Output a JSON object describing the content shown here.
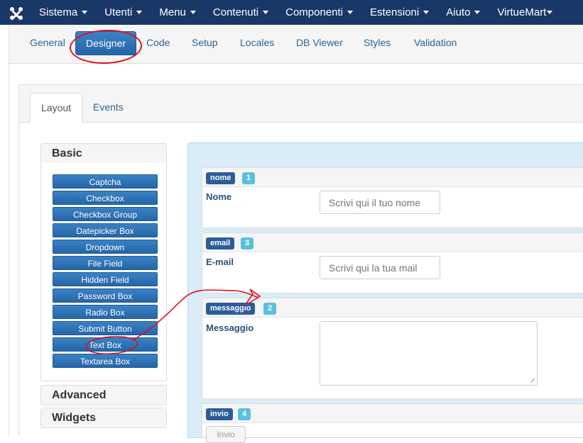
{
  "topbar": {
    "menu": [
      {
        "label": "Sistema",
        "caret": true
      },
      {
        "label": "Utenti",
        "caret": true
      },
      {
        "label": "Menu",
        "caret": true
      },
      {
        "label": "Contenuti",
        "caret": true
      },
      {
        "label": "Componenti",
        "caret": true
      },
      {
        "label": "Estensioni",
        "caret": true
      },
      {
        "label": "Aiuto",
        "caret": true
      },
      {
        "label": "VirtueMart",
        "caret": true
      }
    ]
  },
  "subnav": {
    "tabs": [
      {
        "label": "General",
        "active": false
      },
      {
        "label": "Designer",
        "active": true
      },
      {
        "label": "Code",
        "active": false
      },
      {
        "label": "Setup",
        "active": false
      },
      {
        "label": "Locales",
        "active": false
      },
      {
        "label": "DB Viewer",
        "active": false
      },
      {
        "label": "Styles",
        "active": false
      },
      {
        "label": "Validation",
        "active": false
      }
    ]
  },
  "panel": {
    "tabs": [
      {
        "label": "Layout",
        "active": true
      },
      {
        "label": "Events",
        "active": false
      }
    ]
  },
  "sidebar": {
    "basic_title": "Basic",
    "advanced_title": "Advanced",
    "widgets_title": "Widgets",
    "fields": [
      "Captcha",
      "Checkbox",
      "Checkbox Group",
      "Datepicker Box",
      "Dropdown",
      "File Field",
      "Hidden Field",
      "Password Box",
      "Radio Box",
      "Submit Button",
      "Text Box",
      "Textarea Box"
    ]
  },
  "form": {
    "cards": [
      {
        "tag": "nome",
        "badge": "1",
        "label": "Nome",
        "placeholder": "Scrivi qui il tuo nome",
        "kind": "input"
      },
      {
        "tag": "email",
        "badge": "3",
        "label": "E-mail",
        "placeholder": "Scrivi qui la tua mail",
        "kind": "input"
      },
      {
        "tag": "messaggio",
        "badge": "2",
        "label": "Messaggio",
        "placeholder": "",
        "kind": "textarea"
      },
      {
        "tag": "invio",
        "badge": "4",
        "label": "",
        "placeholder": "",
        "kind": "submit",
        "button_label": "Invio"
      }
    ]
  },
  "colors": {
    "topbar_bg": "#1a3867",
    "primary_button": "#2566a8",
    "badge_info": "#5bc0de",
    "annotation": "#e0101f"
  }
}
